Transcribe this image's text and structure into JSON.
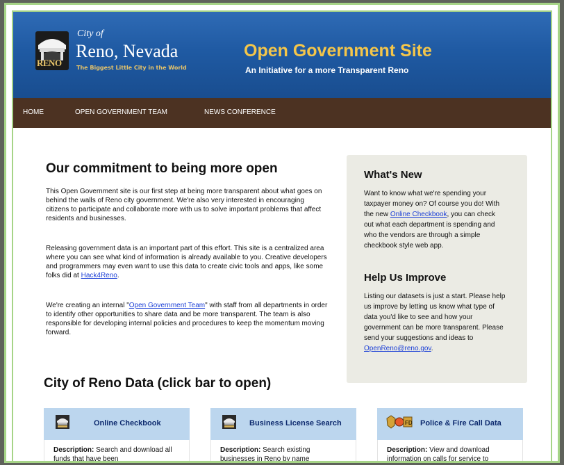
{
  "header": {
    "city_of": "City of",
    "city_name": "Reno, Nevada",
    "stamp": "RENO",
    "tagline": "The Biggest Little City in the World",
    "site_title": "Open Government Site",
    "site_subtitle": "An Initiative for a more Transparent Reno",
    "colors": {
      "header_blue": "#1f5aa3",
      "title_gold": "#f4c64a",
      "nav_brown": "#4c3222"
    }
  },
  "nav": {
    "items": [
      "HOME",
      "OPEN GOVERNMENT TEAM",
      "NEWS CONFERENCE"
    ]
  },
  "main": {
    "heading": "Our commitment to being more open",
    "p1": "This Open Government site is our first step at being more transparent about what goes on behind the walls of Reno city government. We're also very interested in encouraging citizens to participate and collaborate more with us to solve important problems that affect residents and businesses.",
    "p2_before": "Releasing government data is an important part of this effort. This site is a centralized area where you can see what kind of information is already available to you. Creative developers and programmers may even want to use this data to create civic tools and apps, like some folks did at ",
    "p2_link": "Hack4Reno",
    "p2_after": ".",
    "p3_before": "We're creating an internal \"",
    "p3_link": "Open Government Team",
    "p3_after": "\" with staff from all departments in order to identify other opportunities to share data and be more transparent. The team is also responsible for developing internal policies and procedures to keep the momentum moving forward."
  },
  "sidebar": {
    "whats_new_heading": "What's New",
    "whats_new_before": "Want to know what we're spending your taxpayer money on? Of course you do! With the new ",
    "whats_new_link": "Online Checkbook",
    "whats_new_after": ", you can check out what each department is spending and who the vendors are through a simple checkbook style web app.",
    "help_heading": "Help Us Improve",
    "help_text": "Listing our datasets is just a start. Please help us improve by letting us know what type of data you'd like to see and how your government can be more transparent. Please send your suggestions and ideas to ",
    "help_link": "OpenReno@reno.gov",
    "help_after": "."
  },
  "data_section": {
    "heading": "City of Reno Data (click bar to open)",
    "description_label": "Description:",
    "cards": [
      {
        "title": "Online Checkbook",
        "desc": " Search and download all funds that have been",
        "icon": "reno-seal-icon"
      },
      {
        "title": "Business License Search",
        "desc": " Search existing businesses in Reno by name",
        "icon": "reno-seal-icon"
      },
      {
        "title": "Police & Fire Call Data",
        "desc": " View and download information on calls for service to",
        "icon": "police-fire-badge-icon"
      }
    ]
  }
}
